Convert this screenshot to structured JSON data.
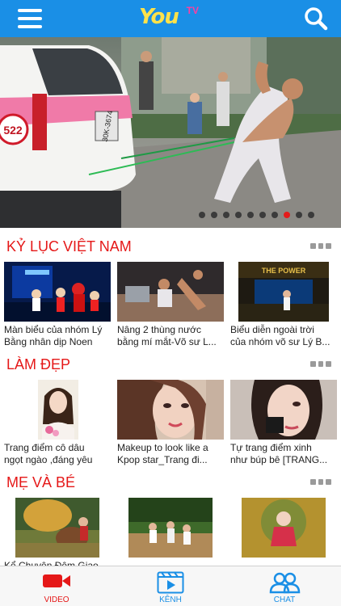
{
  "header": {
    "logo_text": "You",
    "logo_tv": "TV",
    "brand_color": "#1a8fe6"
  },
  "banner": {
    "plate_text": "522",
    "car_plate": "30K-3674",
    "dots_count": 10,
    "active_dot_index": 7
  },
  "sections": [
    {
      "title": "KỶ LỤC VIỆT NAM",
      "items": [
        {
          "line1": "Màn biểu của nhóm Lý",
          "line2": "Bằng nhân dịp Noen"
        },
        {
          "line1": "Nâng 2 thùng nước",
          "line2": "bằng mí mắt-Võ sư L..."
        },
        {
          "line1": "Biểu diễn ngoài trời",
          "line2": "của nhóm võ sư Lý B..."
        }
      ]
    },
    {
      "title": "LÀM ĐẸP",
      "items": [
        {
          "line1": "Trang điểm cô dâu",
          "line2": "ngọt ngào ,đáng yêu"
        },
        {
          "line1": "Makeup to look like a",
          "line2": "Kpop star_Trang đi..."
        },
        {
          "line1": "Tự trang điểm xinh",
          "line2": "như búp bê [TRANG..."
        }
      ]
    },
    {
      "title": "MẸ VÀ BÉ",
      "items": [
        {
          "line1": "Kể Chuyện Đêm Giao",
          "line2": ""
        },
        {
          "line1": "",
          "line2": ""
        },
        {
          "line1": "",
          "line2": ""
        }
      ]
    }
  ],
  "tabbar": {
    "tabs": [
      {
        "label": "VIDEO",
        "active": true
      },
      {
        "label": "KÊNH",
        "active": false
      },
      {
        "label": "CHAT",
        "active": false
      }
    ],
    "active_color": "#e51818",
    "inactive_color": "#1a8fe6"
  }
}
